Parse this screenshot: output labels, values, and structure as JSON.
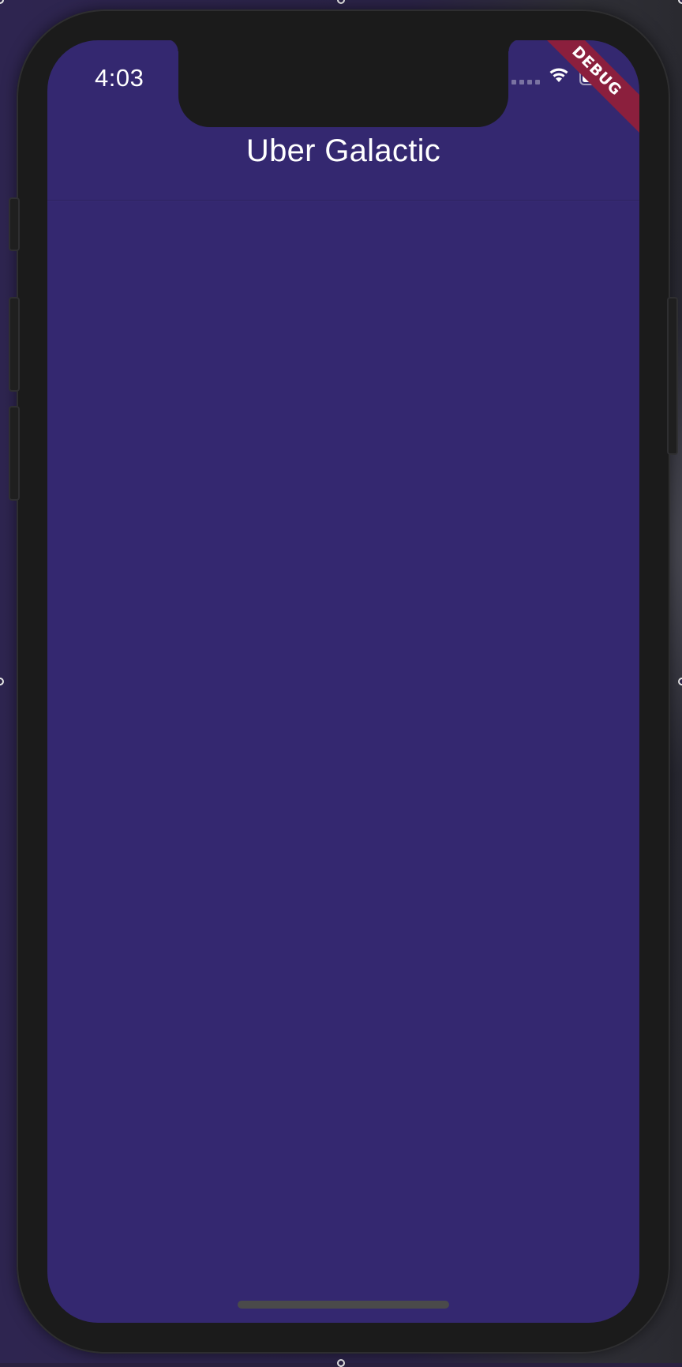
{
  "status_bar": {
    "time": "4:03",
    "wifi_icon": "wifi-icon",
    "battery_icon": "battery-icon"
  },
  "app_bar": {
    "title": "Uber Galactic"
  },
  "debug_banner": {
    "label": "DEBUG"
  },
  "colors": {
    "screen_background": "#342870",
    "device_frame": "#1b1b1b",
    "debug_banner": "#8b1f3d"
  }
}
